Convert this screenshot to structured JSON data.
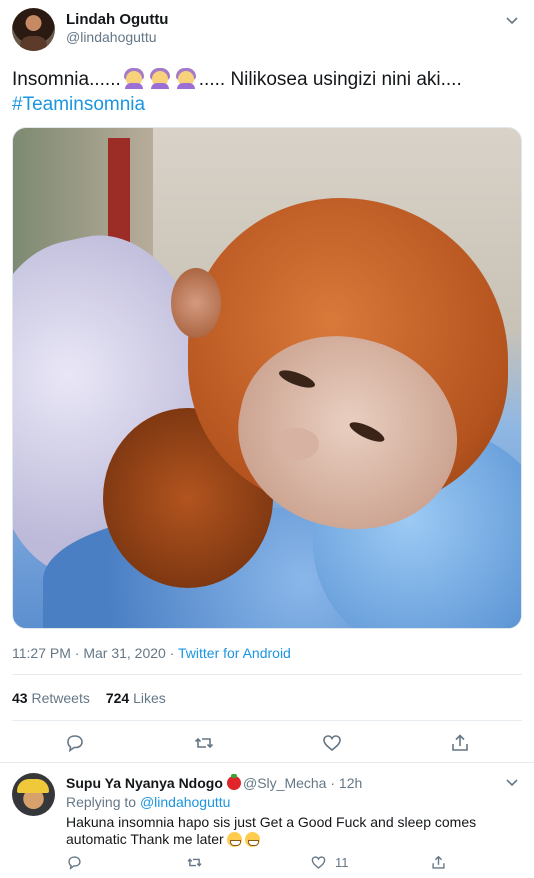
{
  "tweet": {
    "author_name": "Lindah Oguttu",
    "author_handle": "@lindahoguttu",
    "text_prefix": "Insomnia......",
    "text_suffix": "..... Nilikosea usingizi nini aki....",
    "hashtag": "#Teaminsomnia",
    "timestamp": "11:27 PM · Mar 31, 2020 · ",
    "source": "Twitter for Android",
    "retweets_count": "43",
    "retweets_label": "Retweets",
    "likes_count": "724",
    "likes_label": "Likes",
    "emoji_icon": "person-gesturing-no-emoji"
  },
  "reply": {
    "author_name": "Supu Ya Nyanya Ndogo",
    "author_handle": "@Sly_Mecha · 12h",
    "replying_prefix": "Replying to ",
    "replying_to": "@lindahoguttu",
    "text": "Hakuna insomnia hapo sis just Get a Good Fuck and sleep comes automatic Thank me later",
    "likes_count": "11"
  },
  "colors": {
    "link": "#1b95e0",
    "secondary_text": "#657786",
    "primary_text": "#14171a"
  }
}
